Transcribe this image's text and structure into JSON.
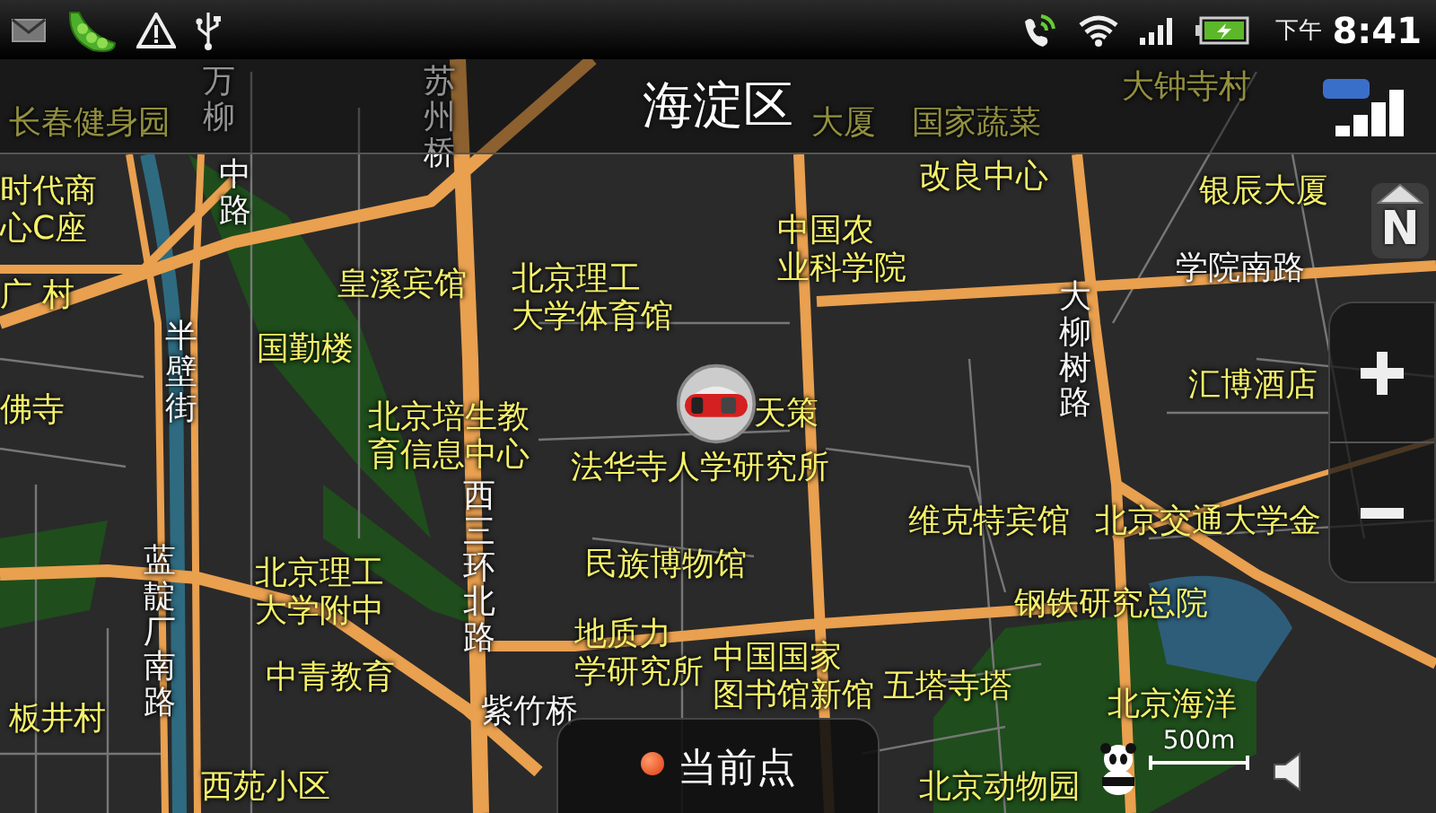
{
  "status_bar": {
    "time_period": "下午",
    "time": "8:41"
  },
  "header": {
    "title": "海淀区"
  },
  "compass": {
    "label": "N"
  },
  "map_labels": [
    {
      "lines": [
        "万柳"
      ],
      "kind": "road-vertical"
    },
    {
      "lines": [
        "苏州桥"
      ],
      "kind": "road-vertical"
    },
    {
      "lines": [
        "大钟寺村"
      ],
      "kind": "poi"
    },
    {
      "lines": [
        "长春健身园"
      ],
      "kind": "poi"
    },
    {
      "lines": [
        "大厦"
      ],
      "kind": "poi"
    },
    {
      "lines": [
        "国家蔬菜"
      ],
      "kind": "poi"
    },
    {
      "lines": [
        "中路"
      ],
      "kind": "road-vertical"
    },
    {
      "lines": [
        "改良中心"
      ],
      "kind": "poi"
    },
    {
      "lines": [
        "时代商",
        "心C座"
      ],
      "kind": "poi"
    },
    {
      "lines": [
        "银辰大厦"
      ],
      "kind": "poi"
    },
    {
      "lines": [
        "中国农",
        "业科学院"
      ],
      "kind": "poi"
    },
    {
      "lines": [
        "学院南路"
      ],
      "kind": "road"
    },
    {
      "lines": [
        "广 村"
      ],
      "kind": "poi"
    },
    {
      "lines": [
        "半壁街"
      ],
      "kind": "road-vertical"
    },
    {
      "lines": [
        "国勤楼"
      ],
      "kind": "poi"
    },
    {
      "lines": [
        "佛寺"
      ],
      "kind": "poi"
    },
    {
      "lines": [
        "皇溪宾馆"
      ],
      "kind": "poi"
    },
    {
      "lines": [
        "北京理工",
        "大学体育馆"
      ],
      "kind": "poi"
    },
    {
      "lines": [
        "北京培生教",
        "育信息中心"
      ],
      "kind": "poi"
    },
    {
      "lines": [
        "天策"
      ],
      "kind": "poi"
    },
    {
      "lines": [
        "大柳树路"
      ],
      "kind": "road-vertical"
    },
    {
      "lines": [
        "汇博酒店"
      ],
      "kind": "poi"
    },
    {
      "lines": [
        "西三环北路"
      ],
      "kind": "road-vertical"
    },
    {
      "lines": [
        "法华寺人学研究所"
      ],
      "kind": "poi"
    },
    {
      "lines": [
        "维克特宾馆"
      ],
      "kind": "poi"
    },
    {
      "lines": [
        "北京交通大学金"
      ],
      "kind": "poi"
    },
    {
      "lines": [
        "蓝靛厂南路"
      ],
      "kind": "road-vertical"
    },
    {
      "lines": [
        "北京理工",
        "大学附中"
      ],
      "kind": "poi"
    },
    {
      "lines": [
        "民族博物馆"
      ],
      "kind": "poi"
    },
    {
      "lines": [
        "地质力",
        "学研究所"
      ],
      "kind": "poi"
    },
    {
      "lines": [
        "钢铁研究总院"
      ],
      "kind": "poi"
    },
    {
      "lines": [
        "板井村"
      ],
      "kind": "poi"
    },
    {
      "lines": [
        "中青教育"
      ],
      "kind": "poi"
    },
    {
      "lines": [
        "紫竹桥"
      ],
      "kind": "road"
    },
    {
      "lines": [
        "中国国家",
        "图书馆新馆"
      ],
      "kind": "poi"
    },
    {
      "lines": [
        "五塔寺塔"
      ],
      "kind": "poi"
    },
    {
      "lines": [
        "北京海洋"
      ],
      "kind": "poi"
    },
    {
      "lines": [
        "西苑小区"
      ],
      "kind": "poi"
    },
    {
      "lines": [
        "北京动物园"
      ],
      "kind": "poi"
    }
  ],
  "current_location_button": {
    "label": "当前点"
  },
  "scale_bar": {
    "label": "500m"
  }
}
